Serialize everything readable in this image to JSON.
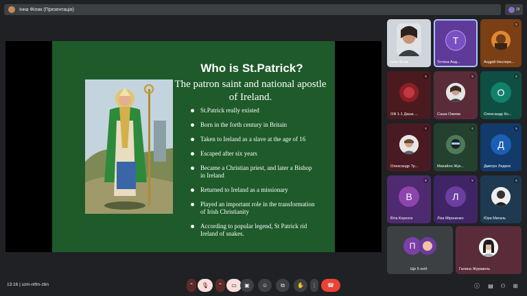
{
  "topbar": {
    "title": "Інна Філик (Презентація)",
    "count": "19"
  },
  "slide": {
    "title": "Who is St.Patrick?",
    "subtitle": "The patron saint and national apostle of Ireland.",
    "bullets": [
      "St.Patrick really existed",
      "Born in the forth century in Britain",
      "Taken to Ireland as a slave at the age of 16",
      "Escaped after six years",
      "Became a Christian priest, and later a Bishop in Ireland",
      "Returned to Ireland as a missionary",
      "Played an important role in the transformation of Irish Christianity",
      "According to popular legend, St Patrick rid Ireland of snakes."
    ]
  },
  "participants": [
    {
      "name": "Інна Філик",
      "initial": "",
      "color": "#9aa3ad"
    },
    {
      "name": "Тетяна Анд...",
      "initial": "Т",
      "color": "#7b4fc4"
    },
    {
      "name": "Андрій Нестеро...",
      "initial": "",
      "color": "#e0862f"
    },
    {
      "name": "ОФ 1-1 Даша ...",
      "initial": "",
      "color": "#5a1e22"
    },
    {
      "name": "Саша Ожема",
      "initial": "",
      "color": "#d6d6d6"
    },
    {
      "name": "Олександр Ко...",
      "initial": "О",
      "color": "#12806a"
    },
    {
      "name": "Олександр Тр...",
      "initial": "",
      "color": "#c9c9c9"
    },
    {
      "name": "Михайло Жук...",
      "initial": "",
      "color": "#3c5a46"
    },
    {
      "name": "Дмитро Лядкоя",
      "initial": "Д",
      "color": "#1a5fb4"
    },
    {
      "name": "Віта Коренга",
      "initial": "В",
      "color": "#8e44ad"
    },
    {
      "name": "Ліза Міроненко",
      "initial": "Л",
      "color": "#6a3fa0"
    },
    {
      "name": "Юра Мигаль",
      "initial": "",
      "color": "#d9d9d9"
    },
    {
      "name": "Ще 5 осіб",
      "initial": "П",
      "color": "#7b3fa8"
    },
    {
      "name": "Галина Журавель",
      "initial": "",
      "color": "#efefef"
    }
  ],
  "bottombar": {
    "time_code": "13:16  |  szm-ntfm-zbn"
  },
  "colors": {
    "slide_bg": "#1e5a2a",
    "end_call": "#ea4335",
    "background": "#202124"
  },
  "icons": {
    "mic": "mic-off-icon",
    "cam": "camera-off-icon",
    "cc": "captions-icon",
    "emoji": "emoji-icon",
    "present": "present-icon",
    "hand": "raise-hand-icon",
    "more": "more-vert-icon",
    "end": "end-call-icon"
  }
}
